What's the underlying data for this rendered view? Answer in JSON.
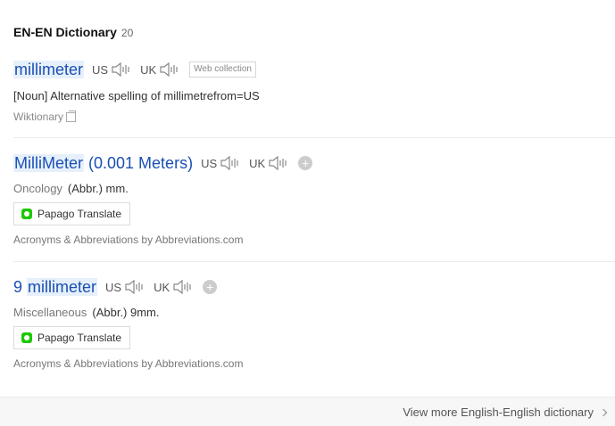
{
  "header": {
    "title": "EN-EN Dictionary",
    "count": "20"
  },
  "entries": [
    {
      "headword": "millimeter",
      "us": "US",
      "uk": "UK",
      "tag": "Web collection",
      "definition": "[Noun] Alternative spelling of millimetrefrom=US",
      "source": "Wiktionary"
    },
    {
      "headword": "MilliMeter",
      "headword_rest": " (0.001 Meters)",
      "us": "US",
      "uk": "UK",
      "category": "Oncology",
      "definition": "(Abbr.) mm.",
      "papago": "Papago Translate",
      "source": "Acronyms & Abbreviations by Abbreviations.com"
    },
    {
      "prefix": "9 ",
      "headword": "millimeter",
      "us": "US",
      "uk": "UK",
      "category": "Miscellaneous",
      "definition": "(Abbr.) 9mm.",
      "papago": "Papago Translate",
      "source": "Acronyms & Abbreviations by Abbreviations.com"
    }
  ],
  "footer": {
    "more_label": "View more English-English dictionary"
  },
  "icons": {
    "speaker": "speaker-icon",
    "plus": "add-icon",
    "copy": "copy-icon",
    "papago": "papago-icon",
    "chevron": "chevron-right-icon"
  },
  "colors": {
    "headword": "#1a4fb3",
    "highlight": "#e6f0fb",
    "papago": "#1ec800"
  }
}
